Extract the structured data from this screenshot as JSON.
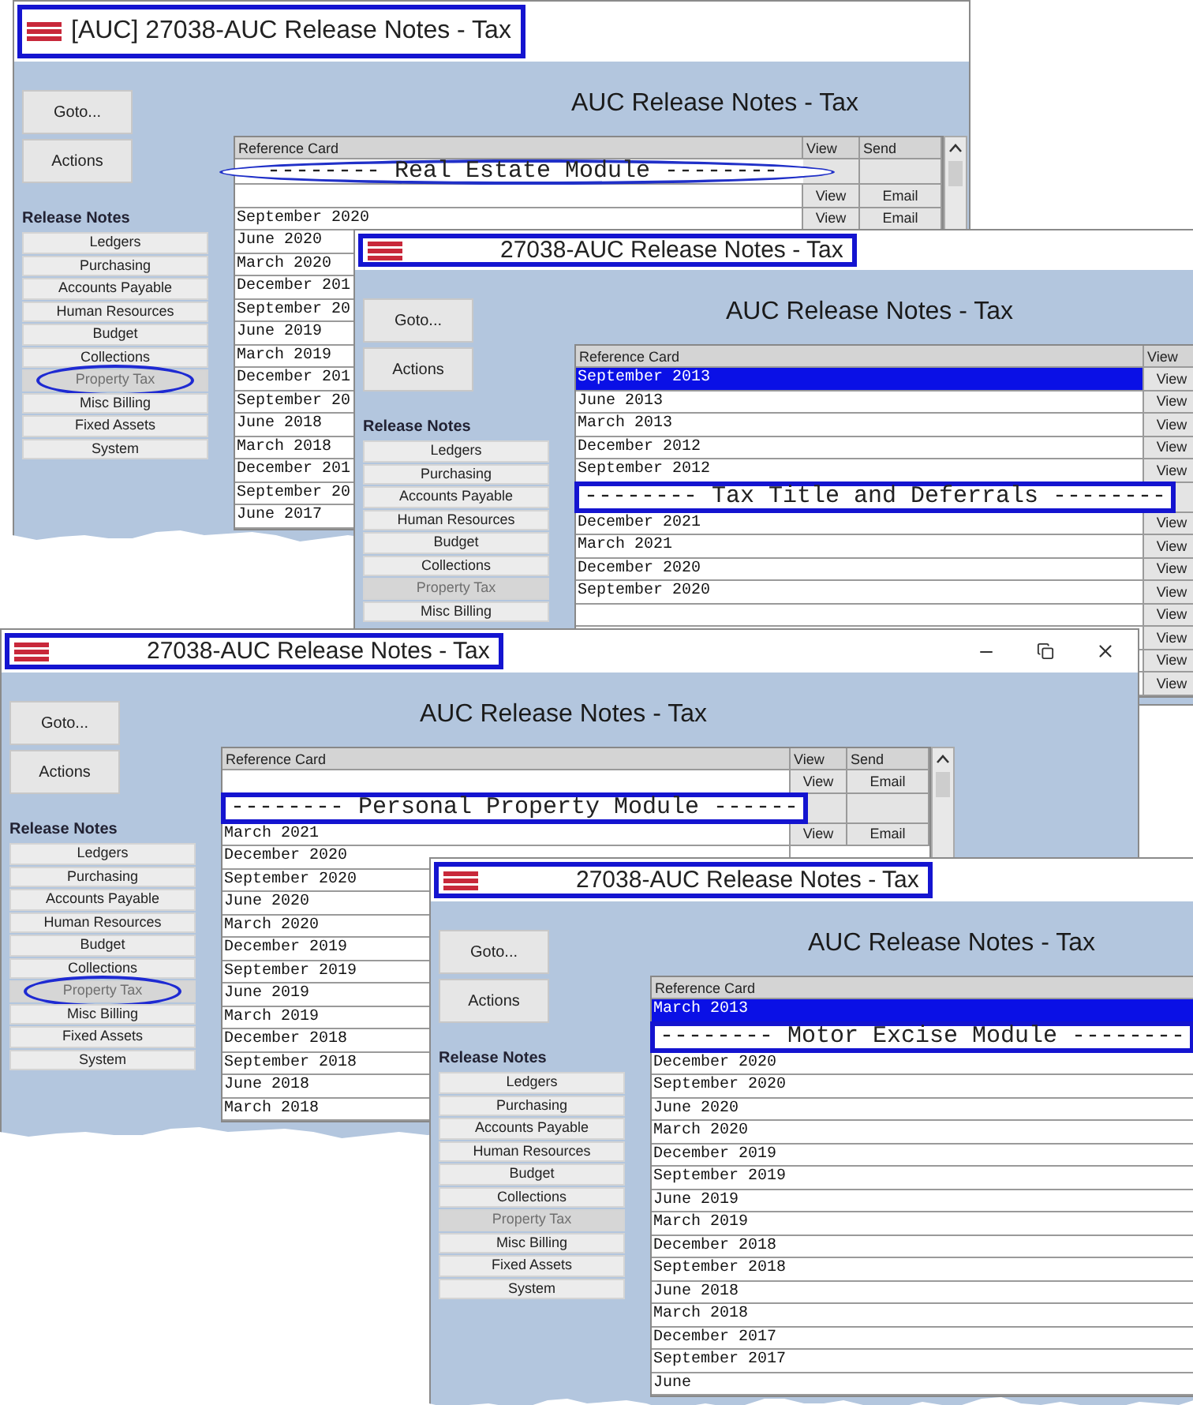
{
  "windows": [
    {
      "title": "[AUC] 27038-AUC Release Notes - Tax",
      "heading": "AUC Release Notes - Tax",
      "goto": "Goto...",
      "actions": "Actions",
      "section": "Release Notes",
      "scrollbar": true,
      "window_controls": false,
      "modules": [
        {
          "label": "Ledgers",
          "disabled": false,
          "circled": false
        },
        {
          "label": "Purchasing",
          "disabled": false,
          "circled": false
        },
        {
          "label": "Accounts Payable",
          "disabled": false,
          "circled": false
        },
        {
          "label": "Human Resources",
          "disabled": false,
          "circled": false
        },
        {
          "label": "Budget",
          "disabled": false,
          "circled": false
        },
        {
          "label": "Collections",
          "disabled": false,
          "circled": false
        },
        {
          "label": "Property Tax",
          "disabled": true,
          "circled": true
        },
        {
          "label": "Misc Billing",
          "disabled": false,
          "circled": false
        },
        {
          "label": "Fixed Assets",
          "disabled": false,
          "circled": false
        },
        {
          "label": "System",
          "disabled": false,
          "circled": false
        }
      ],
      "columns": [
        "Reference Card",
        "View",
        "Send"
      ],
      "rows": [
        {
          "kind": "banner",
          "text": "-------- Real Estate Module --------",
          "circled": true
        },
        {
          "kind": "entry",
          "view": "View",
          "send": "Email",
          "selected": false
        },
        {
          "kind": "entry",
          "card": "September 2020",
          "view": "View",
          "send": "Email",
          "selected": false
        },
        {
          "kind": "entry",
          "card": "June 2020",
          "selected": false
        },
        {
          "kind": "entry",
          "card": "March 2020",
          "selected": false
        },
        {
          "kind": "entry",
          "card": "December 201",
          "selected": false
        },
        {
          "kind": "entry",
          "card": "September 20",
          "selected": false
        },
        {
          "kind": "entry",
          "card": "June 2019",
          "selected": false
        },
        {
          "kind": "entry",
          "card": "March 2019",
          "selected": false
        },
        {
          "kind": "entry",
          "card": "December 201",
          "selected": false
        },
        {
          "kind": "entry",
          "card": "September 20",
          "selected": false
        },
        {
          "kind": "entry",
          "card": "June 2018",
          "selected": false
        },
        {
          "kind": "entry",
          "card": "March 2018",
          "selected": false
        },
        {
          "kind": "entry",
          "card": "December 201",
          "selected": false
        },
        {
          "kind": "entry",
          "card": "September 20",
          "selected": false
        },
        {
          "kind": "entry",
          "card": "June 2017",
          "selected": false
        }
      ]
    },
    {
      "title": "27038-AUC Release Notes - Tax",
      "heading": "AUC Release Notes - Tax",
      "goto": "Goto...",
      "actions": "Actions",
      "section": "Release Notes",
      "scrollbar": false,
      "window_controls": false,
      "modules": [
        {
          "label": "Ledgers",
          "disabled": false,
          "circled": false
        },
        {
          "label": "Purchasing",
          "disabled": false,
          "circled": false
        },
        {
          "label": "Accounts Payable",
          "disabled": false,
          "circled": false
        },
        {
          "label": "Human Resources",
          "disabled": false,
          "circled": false
        },
        {
          "label": "Budget",
          "disabled": false,
          "circled": false
        },
        {
          "label": "Collections",
          "disabled": false,
          "circled": false
        },
        {
          "label": "Property Tax",
          "disabled": true,
          "circled": false
        },
        {
          "label": "Misc Billing",
          "disabled": false,
          "circled": false
        }
      ],
      "columns": [
        "Reference Card",
        "View"
      ],
      "rows": [
        {
          "kind": "entry",
          "card": "September 2013",
          "view": "View",
          "selected": true
        },
        {
          "kind": "entry",
          "card": "June 2013",
          "view": "View",
          "selected": false
        },
        {
          "kind": "entry",
          "card": "March 2013",
          "view": "View",
          "selected": false
        },
        {
          "kind": "entry",
          "card": "December 2012",
          "view": "View",
          "selected": false
        },
        {
          "kind": "entry",
          "card": "September 2012",
          "view": "View",
          "selected": false
        },
        {
          "kind": "banner",
          "text": "-------- Tax Title and Deferrals --------",
          "circled": false
        },
        {
          "kind": "entry",
          "card": "December 2021",
          "view": "View",
          "selected": false
        },
        {
          "kind": "entry",
          "card": "March 2021",
          "view": "View",
          "selected": false
        },
        {
          "kind": "entry",
          "card": "December 2020",
          "view": "View",
          "selected": false
        },
        {
          "kind": "entry",
          "card": "September 2020",
          "view": "View",
          "selected": false
        },
        {
          "kind": "entry",
          "view": "View",
          "selected": false
        },
        {
          "kind": "entry",
          "view": "View",
          "selected": false
        },
        {
          "kind": "entry",
          "view": "View",
          "selected": false
        },
        {
          "kind": "entry",
          "view": "View",
          "selected": false
        }
      ]
    },
    {
      "title": "27038-AUC Release Notes - Tax",
      "heading": "AUC Release Notes - Tax",
      "goto": "Goto...",
      "actions": "Actions",
      "section": "Release Notes",
      "scrollbar": true,
      "window_controls": true,
      "modules": [
        {
          "label": "Ledgers",
          "disabled": false,
          "circled": false
        },
        {
          "label": "Purchasing",
          "disabled": false,
          "circled": false
        },
        {
          "label": "Accounts Payable",
          "disabled": false,
          "circled": false
        },
        {
          "label": "Human Resources",
          "disabled": false,
          "circled": false
        },
        {
          "label": "Budget",
          "disabled": false,
          "circled": false
        },
        {
          "label": "Collections",
          "disabled": false,
          "circled": false
        },
        {
          "label": "Property Tax",
          "disabled": true,
          "circled": true
        },
        {
          "label": "Misc Billing",
          "disabled": false,
          "circled": false
        },
        {
          "label": "Fixed Assets",
          "disabled": false,
          "circled": false
        },
        {
          "label": "System",
          "disabled": false,
          "circled": false
        }
      ],
      "columns": [
        "Reference Card",
        "View",
        "Send"
      ],
      "rows": [
        {
          "kind": "entry",
          "view": "View",
          "send": "Email",
          "selected": false
        },
        {
          "kind": "banner",
          "text": "-------- Personal Property Module ------",
          "circled": false
        },
        {
          "kind": "entry",
          "card": "March 2021",
          "view": "View",
          "send": "Email",
          "selected": false
        },
        {
          "kind": "entry",
          "card": "December 2020",
          "selected": false
        },
        {
          "kind": "entry",
          "card": "September 2020",
          "selected": false
        },
        {
          "kind": "entry",
          "card": "June 2020",
          "selected": false
        },
        {
          "kind": "entry",
          "card": "March 2020",
          "selected": false
        },
        {
          "kind": "entry",
          "card": "December 2019",
          "selected": false
        },
        {
          "kind": "entry",
          "card": "September 2019",
          "selected": false
        },
        {
          "kind": "entry",
          "card": "June 2019",
          "selected": false
        },
        {
          "kind": "entry",
          "card": "March 2019",
          "selected": false
        },
        {
          "kind": "entry",
          "card": "December 2018",
          "selected": false
        },
        {
          "kind": "entry",
          "card": "September 2018",
          "selected": false
        },
        {
          "kind": "entry",
          "card": "June 2018",
          "selected": false
        },
        {
          "kind": "entry",
          "card": "March 2018",
          "selected": false
        }
      ]
    },
    {
      "title": "27038-AUC Release Notes - Tax",
      "heading": "AUC Release Notes - Tax",
      "goto": "Goto...",
      "actions": "Actions",
      "section": "Release Notes",
      "scrollbar": false,
      "window_controls": false,
      "modules": [
        {
          "label": "Ledgers",
          "disabled": false,
          "circled": false
        },
        {
          "label": "Purchasing",
          "disabled": false,
          "circled": false
        },
        {
          "label": "Accounts Payable",
          "disabled": false,
          "circled": false
        },
        {
          "label": "Human Resources",
          "disabled": false,
          "circled": false
        },
        {
          "label": "Budget",
          "disabled": false,
          "circled": false
        },
        {
          "label": "Collections",
          "disabled": false,
          "circled": false
        },
        {
          "label": "Property Tax",
          "disabled": true,
          "circled": false
        },
        {
          "label": "Misc Billing",
          "disabled": false,
          "circled": false
        },
        {
          "label": "Fixed Assets",
          "disabled": false,
          "circled": false
        },
        {
          "label": "System",
          "disabled": false,
          "circled": false
        }
      ],
      "columns": [
        "Reference Card"
      ],
      "rows": [
        {
          "kind": "entry",
          "card": "March 2013",
          "selected": true
        },
        {
          "kind": "banner",
          "text": "-------- Motor Excise Module --------",
          "circled": false
        },
        {
          "kind": "entry",
          "card": "December 2020",
          "selected": false
        },
        {
          "kind": "entry",
          "card": "September 2020",
          "selected": false
        },
        {
          "kind": "entry",
          "card": "June 2020",
          "selected": false
        },
        {
          "kind": "entry",
          "card": "March 2020",
          "selected": false
        },
        {
          "kind": "entry",
          "card": "December 2019",
          "selected": false
        },
        {
          "kind": "entry",
          "card": "September 2019",
          "selected": false
        },
        {
          "kind": "entry",
          "card": "June 2019",
          "selected": false
        },
        {
          "kind": "entry",
          "card": "March 2019",
          "selected": false
        },
        {
          "kind": "entry",
          "card": "December 2018",
          "selected": false
        },
        {
          "kind": "entry",
          "card": "September 2018",
          "selected": false
        },
        {
          "kind": "entry",
          "card": "June 2018",
          "selected": false
        },
        {
          "kind": "entry",
          "card": "March 2018",
          "selected": false
        },
        {
          "kind": "entry",
          "card": "December 2017",
          "selected": false
        },
        {
          "kind": "entry",
          "card": "September 2017",
          "selected": false
        },
        {
          "kind": "entry",
          "card": "June",
          "selected": false
        }
      ]
    }
  ]
}
